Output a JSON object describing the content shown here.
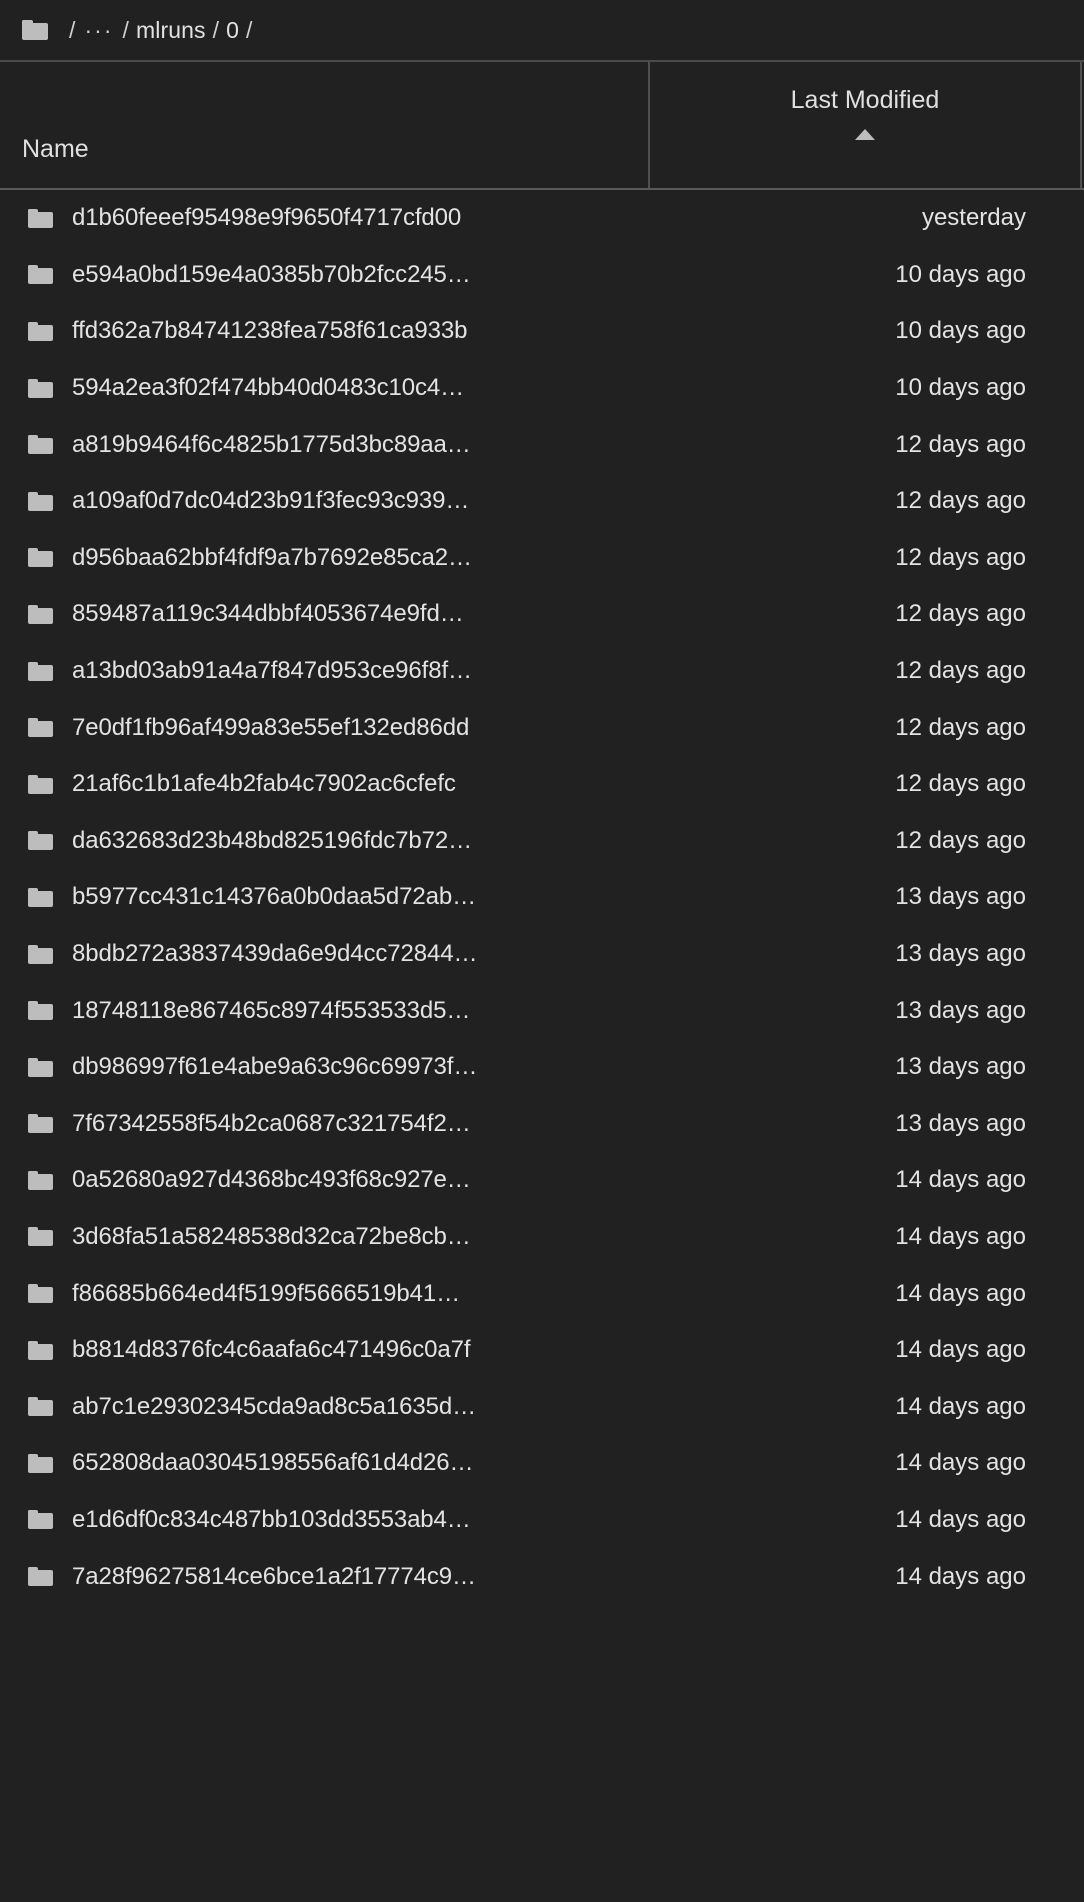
{
  "breadcrumb": {
    "home_icon": "folder-icon",
    "separator": "/",
    "ellipsis": "···",
    "segments": [
      "mlruns",
      "0"
    ]
  },
  "columns": {
    "name_label": "Name",
    "modified_label": "Last Modified",
    "sort_indicator": "ascending-triangle"
  },
  "rows": [
    {
      "icon": "folder-icon",
      "name": "d1b60feeef95498e9f9650f4717cfd00",
      "modified": "yesterday"
    },
    {
      "icon": "folder-icon",
      "name": "e594a0bd159e4a0385b70b2fcc245…",
      "modified": "10 days ago"
    },
    {
      "icon": "folder-icon",
      "name": "ffd362a7b84741238fea758f61ca933b",
      "modified": "10 days ago"
    },
    {
      "icon": "folder-icon",
      "name": "594a2ea3f02f474bb40d0483c10c4…",
      "modified": "10 days ago"
    },
    {
      "icon": "folder-icon",
      "name": "a819b9464f6c4825b1775d3bc89aa…",
      "modified": "12 days ago"
    },
    {
      "icon": "folder-icon",
      "name": "a109af0d7dc04d23b91f3fec93c939…",
      "modified": "12 days ago"
    },
    {
      "icon": "folder-icon",
      "name": "d956baa62bbf4fdf9a7b7692e85ca2…",
      "modified": "12 days ago"
    },
    {
      "icon": "folder-icon",
      "name": "859487a119c344dbbf4053674e9fd…",
      "modified": "12 days ago"
    },
    {
      "icon": "folder-icon",
      "name": "a13bd03ab91a4a7f847d953ce96f8f…",
      "modified": "12 days ago"
    },
    {
      "icon": "folder-icon",
      "name": "7e0df1fb96af499a83e55ef132ed86dd",
      "modified": "12 days ago"
    },
    {
      "icon": "folder-icon",
      "name": "21af6c1b1afe4b2fab4c7902ac6cfefc",
      "modified": "12 days ago"
    },
    {
      "icon": "folder-icon",
      "name": "da632683d23b48bd825196fdc7b72…",
      "modified": "12 days ago"
    },
    {
      "icon": "folder-icon",
      "name": "b5977cc431c14376a0b0daa5d72ab…",
      "modified": "13 days ago"
    },
    {
      "icon": "folder-icon",
      "name": "8bdb272a3837439da6e9d4cc72844…",
      "modified": "13 days ago"
    },
    {
      "icon": "folder-icon",
      "name": "18748118e867465c8974f553533d5…",
      "modified": "13 days ago"
    },
    {
      "icon": "folder-icon",
      "name": "db986997f61e4abe9a63c96c69973f…",
      "modified": "13 days ago"
    },
    {
      "icon": "folder-icon",
      "name": "7f67342558f54b2ca0687c321754f2…",
      "modified": "13 days ago"
    },
    {
      "icon": "folder-icon",
      "name": "0a52680a927d4368bc493f68c927e…",
      "modified": "14 days ago"
    },
    {
      "icon": "folder-icon",
      "name": "3d68fa51a58248538d32ca72be8cb…",
      "modified": "14 days ago"
    },
    {
      "icon": "folder-icon",
      "name": "f86685b664ed4f5199f5666519b41…",
      "modified": "14 days ago"
    },
    {
      "icon": "folder-icon",
      "name": "b8814d8376fc4c6aafa6c471496c0a7f",
      "modified": "14 days ago"
    },
    {
      "icon": "folder-icon",
      "name": "ab7c1e29302345cda9ad8c5a1635d…",
      "modified": "14 days ago"
    },
    {
      "icon": "folder-icon",
      "name": "652808daa03045198556af61d4d26…",
      "modified": "14 days ago"
    },
    {
      "icon": "folder-icon",
      "name": "e1d6df0c834c487bb103dd3553ab4…",
      "modified": "14 days ago"
    },
    {
      "icon": "folder-icon",
      "name": "7a28f96275814ce6bce1a2f17774c9…",
      "modified": "14 days ago"
    }
  ],
  "colors": {
    "background": "#212121",
    "text": "#e3e3e3",
    "icon": "#bdbdbd",
    "divider": "#4f4f4f"
  }
}
